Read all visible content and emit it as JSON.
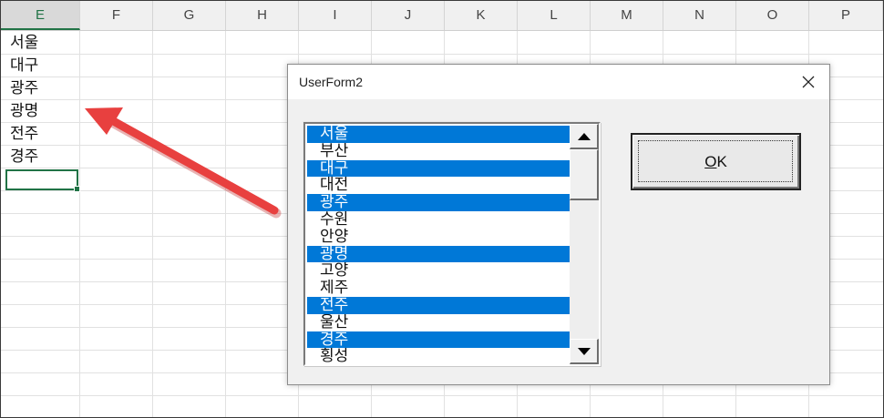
{
  "sheet": {
    "columns": [
      "E",
      "F",
      "G",
      "H",
      "I",
      "J",
      "K",
      "L",
      "M",
      "N",
      "O",
      "P"
    ],
    "active_column": "E",
    "cells": [
      "서울",
      "대구",
      "광주",
      "광명",
      "전주",
      "경주"
    ]
  },
  "dialog": {
    "title": "UserForm2",
    "close_glyph": "✕",
    "ok_mnemonic": "O",
    "ok_rest": "K",
    "list": [
      {
        "label": "서울",
        "selected": true
      },
      {
        "label": "부산",
        "selected": false
      },
      {
        "label": "대구",
        "selected": true
      },
      {
        "label": "대전",
        "selected": false
      },
      {
        "label": "광주",
        "selected": true
      },
      {
        "label": "수원",
        "selected": false
      },
      {
        "label": "안양",
        "selected": false
      },
      {
        "label": "광명",
        "selected": true
      },
      {
        "label": "고양",
        "selected": false
      },
      {
        "label": "제주",
        "selected": false
      },
      {
        "label": "전주",
        "selected": true
      },
      {
        "label": "울산",
        "selected": false
      },
      {
        "label": "경주",
        "selected": true
      },
      {
        "label": "횡성",
        "selected": false
      }
    ]
  },
  "colors": {
    "selection": "#0078d7",
    "excel_green": "#217346",
    "arrow": "#e8403f"
  }
}
